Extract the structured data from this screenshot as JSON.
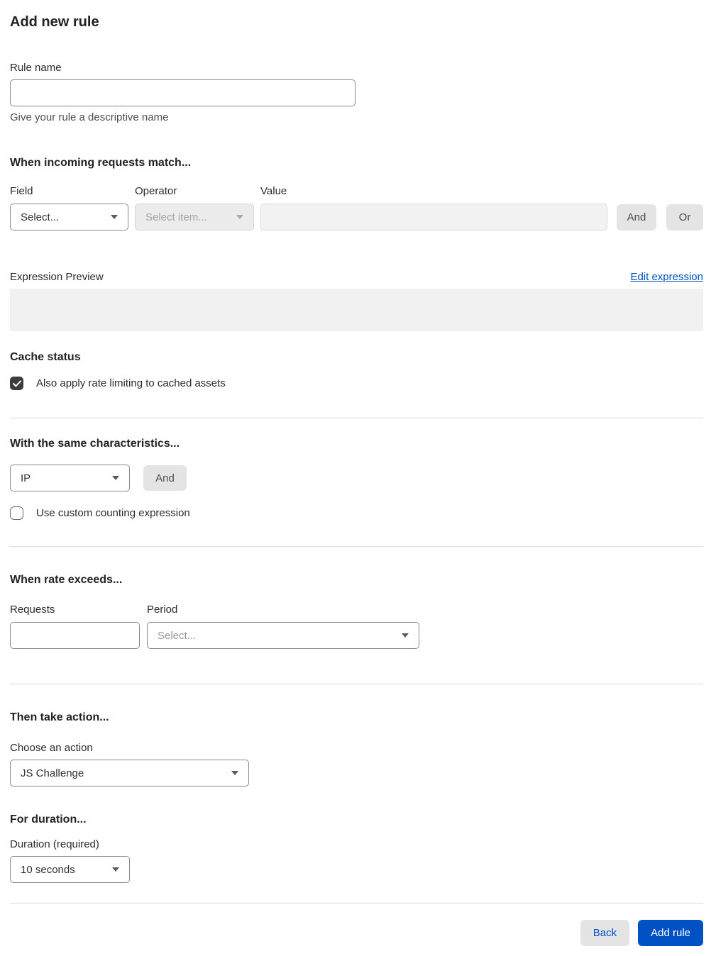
{
  "page": {
    "title": "Add new rule"
  },
  "rule_name": {
    "label": "Rule name",
    "value": "",
    "helper": "Give your rule a descriptive name"
  },
  "match_section": {
    "heading": "When incoming requests match...",
    "field": {
      "label": "Field",
      "value": "Select..."
    },
    "operator": {
      "label": "Operator",
      "value": "Select item...",
      "disabled": true
    },
    "value": {
      "label": "Value",
      "value": "",
      "disabled": true
    },
    "and_button": "And",
    "or_button": "Or",
    "expression_preview": {
      "label": "Expression Preview",
      "edit_link": "Edit expression",
      "content": ""
    }
  },
  "cache_section": {
    "heading": "Cache status",
    "checkbox_label": "Also apply rate limiting to cached assets",
    "checked": true
  },
  "characteristics_section": {
    "heading": "With the same characteristics...",
    "select_value": "IP",
    "and_button": "And",
    "checkbox_label": "Use custom counting expression",
    "checked": false
  },
  "rate_section": {
    "heading": "When rate exceeds...",
    "requests": {
      "label": "Requests",
      "value": ""
    },
    "period": {
      "label": "Period",
      "value": "Select..."
    }
  },
  "action_section": {
    "heading": "Then take action...",
    "choose_label": "Choose an action",
    "select_value": "JS Challenge"
  },
  "duration_section": {
    "heading": "For duration...",
    "label": "Duration (required)",
    "select_value": "10 seconds"
  },
  "footer": {
    "back_button": "Back",
    "add_rule_button": "Add rule"
  },
  "colors": {
    "accent_blue": "#0051c3",
    "checkbox_checked": "#3d3d3d",
    "disabled_bg": "#ececec",
    "preview_bg": "#f1f1f1",
    "divider": "#dcdcdc"
  }
}
